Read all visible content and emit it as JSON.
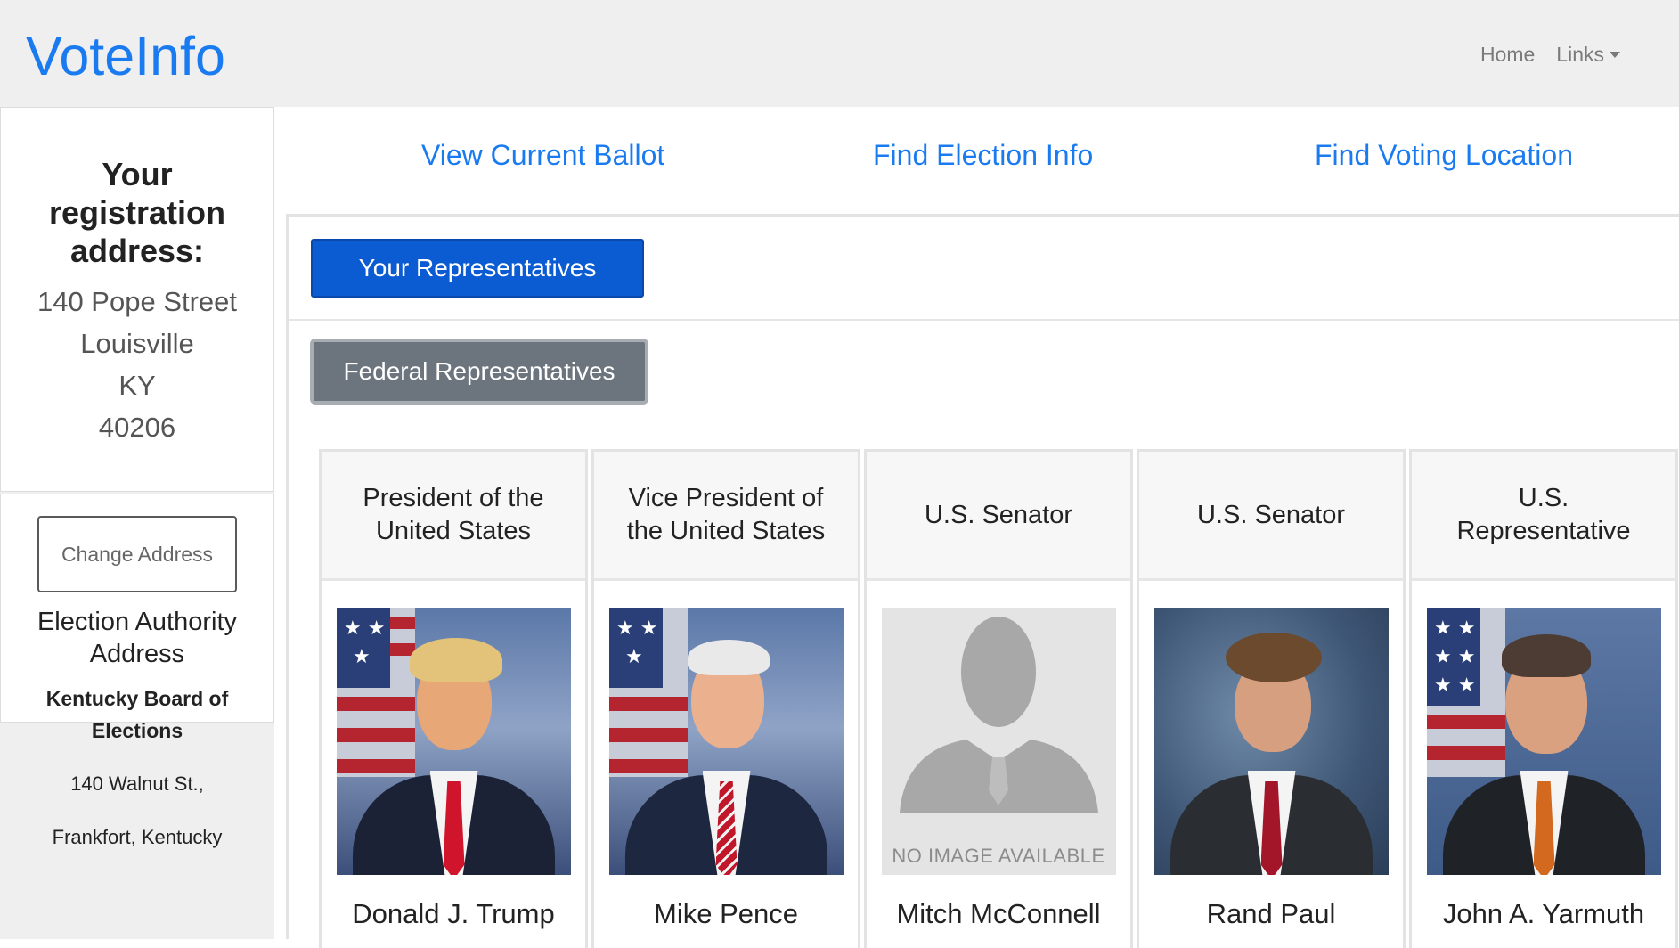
{
  "brand": "VoteInfo",
  "nav": {
    "home": "Home",
    "links": "Links"
  },
  "sidebar": {
    "registration_title": "Your registration address:",
    "address": [
      "140 Pope Street",
      "Louisville",
      "KY",
      "40206"
    ],
    "change_address": "Change Address",
    "authority_title": "Election Authority Address",
    "authority_name": "Kentucky Board of Elections",
    "authority_street": "140 Walnut St.,",
    "authority_city": "Frankfort, Kentucky"
  },
  "tabs": {
    "ballot": "View Current Ballot",
    "election_info": "Find Election Info",
    "voting_location": "Find Voting Location"
  },
  "panel": {
    "representatives_button": "Your Representatives",
    "federal_button": "Federal Representatives"
  },
  "representatives": [
    {
      "office": "President of the United States",
      "name": "Donald J. Trump"
    },
    {
      "office": "Vice President of the United States",
      "name": "Mike Pence"
    },
    {
      "office": "U.S. Senator",
      "name": "Mitch McConnell",
      "no_image_text": "NO IMAGE AVAILABLE"
    },
    {
      "office": "U.S. Senator",
      "name": "Rand Paul"
    },
    {
      "office": "U.S. Representative",
      "name": "John A. Yarmuth"
    }
  ],
  "colors": {
    "brand": "#1a7bf0",
    "primary_button": "#0b5bd3",
    "secondary_button": "#6c757d"
  }
}
